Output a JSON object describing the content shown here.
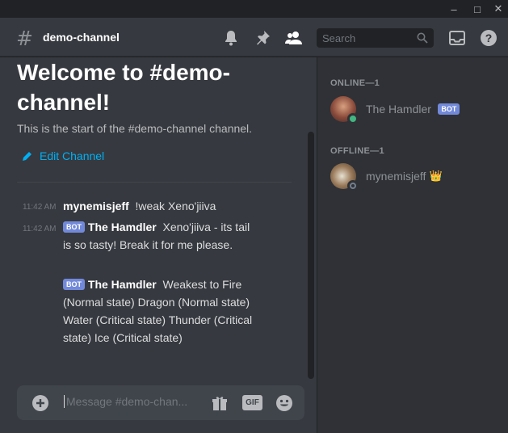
{
  "window": {
    "minimize": "–",
    "maximize": "□",
    "close": "✕"
  },
  "header": {
    "hash_symbol": "#",
    "channel_name": "demo-channel",
    "search_placeholder": "Search"
  },
  "welcome": {
    "title": "Welcome to #demo-channel!",
    "subtitle": "This is the start of the #demo-channel channel.",
    "edit_label": "Edit Channel"
  },
  "messages": [
    {
      "time": "11:42 AM",
      "author": "mynemisjeff",
      "bot": false,
      "badge": "",
      "text": "!weak Xeno'jiiva"
    },
    {
      "time": "11:42 AM",
      "author": "The Hamdler",
      "bot": true,
      "badge": "BOT",
      "text": "Xeno'jiiva - its tail is so tasty! Break it for me please."
    },
    {
      "time": "",
      "author": "The Hamdler",
      "bot": true,
      "badge": "BOT",
      "text": "Weakest to Fire (Normal state) Dragon (Normal state) Water (Critical state) Thunder (Critical state) Ice (Critical state)"
    }
  ],
  "composer": {
    "placeholder": "Message #demo-chan...",
    "gif_label": "GIF"
  },
  "members": {
    "online_title": "ONLINE—1",
    "offline_title": "OFFLINE—1",
    "online": [
      {
        "name": "The Hamdler",
        "badge": "BOT",
        "status": "online"
      }
    ],
    "offline": [
      {
        "name": "mynemisjeff",
        "crown": "👑",
        "status": "offline"
      }
    ]
  },
  "colors": {
    "accent": "#7289da",
    "link": "#00b0f4",
    "online": "#43b581",
    "offline": "#747f8d",
    "crown": "#faa61a"
  }
}
